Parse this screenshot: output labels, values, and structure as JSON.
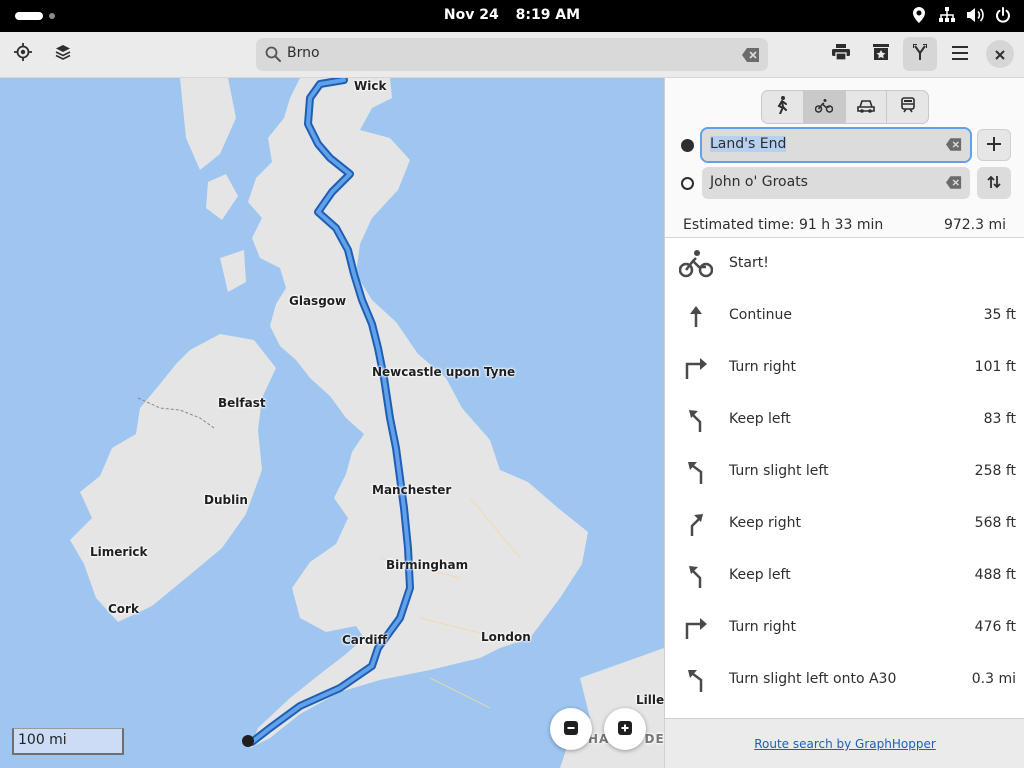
{
  "topbar": {
    "date": "Nov 24",
    "time": "8:19 AM",
    "tray_icons": [
      "location-icon",
      "network-icon",
      "volume-icon",
      "power-icon"
    ]
  },
  "header": {
    "search_value": "Brno",
    "left_buttons": [
      "locate-icon",
      "layers-icon"
    ],
    "right_buttons": [
      "print-icon",
      "favorites-icon",
      "route-icon",
      "menu-icon",
      "close-icon"
    ]
  },
  "map": {
    "cities": [
      {
        "name": "Wick"
      },
      {
        "name": "Glasgow"
      },
      {
        "name": "Belfast"
      },
      {
        "name": "Newcastle upon Tyne"
      },
      {
        "name": "Dublin"
      },
      {
        "name": "Manchester"
      },
      {
        "name": "Limerick"
      },
      {
        "name": "Birmingham"
      },
      {
        "name": "Cork"
      },
      {
        "name": "Cardiff"
      },
      {
        "name": "London"
      },
      {
        "name": "Lille"
      },
      {
        "name": "HAUTS-DE-FR"
      }
    ],
    "scale_label": "100 mi",
    "colors": {
      "water": "#9ec6f0",
      "land": "#e5e5e5",
      "route": "#3584e4"
    }
  },
  "sidebar": {
    "modes": [
      "pedestrian-icon",
      "bicycle-icon",
      "car-icon",
      "transit-icon"
    ],
    "selected_mode": "bicycle-icon",
    "from": "Land's End",
    "to": "John o' Groats",
    "estimated_time": "Estimated time: 91 h 33 min",
    "total_distance": "972.3 mi",
    "instructions": [
      {
        "icon": "bicycle-icon",
        "text": "Start!",
        "distance": ""
      },
      {
        "icon": "arrow-up-icon",
        "text": "Continue",
        "distance": "35 ft"
      },
      {
        "icon": "turn-right-icon",
        "text": "Turn right",
        "distance": "101 ft"
      },
      {
        "icon": "keep-left-icon",
        "text": "Keep left",
        "distance": "83 ft"
      },
      {
        "icon": "slight-left-icon",
        "text": "Turn slight left",
        "distance": "258 ft"
      },
      {
        "icon": "keep-right-icon",
        "text": "Keep right",
        "distance": "568 ft"
      },
      {
        "icon": "keep-left-icon",
        "text": "Keep left",
        "distance": "488 ft"
      },
      {
        "icon": "turn-right-icon",
        "text": "Turn right",
        "distance": "476 ft"
      },
      {
        "icon": "slight-left-icon",
        "text": "Turn slight left onto A30",
        "distance": "0.3 mi"
      }
    ],
    "footer_link": "Route search by GraphHopper"
  }
}
